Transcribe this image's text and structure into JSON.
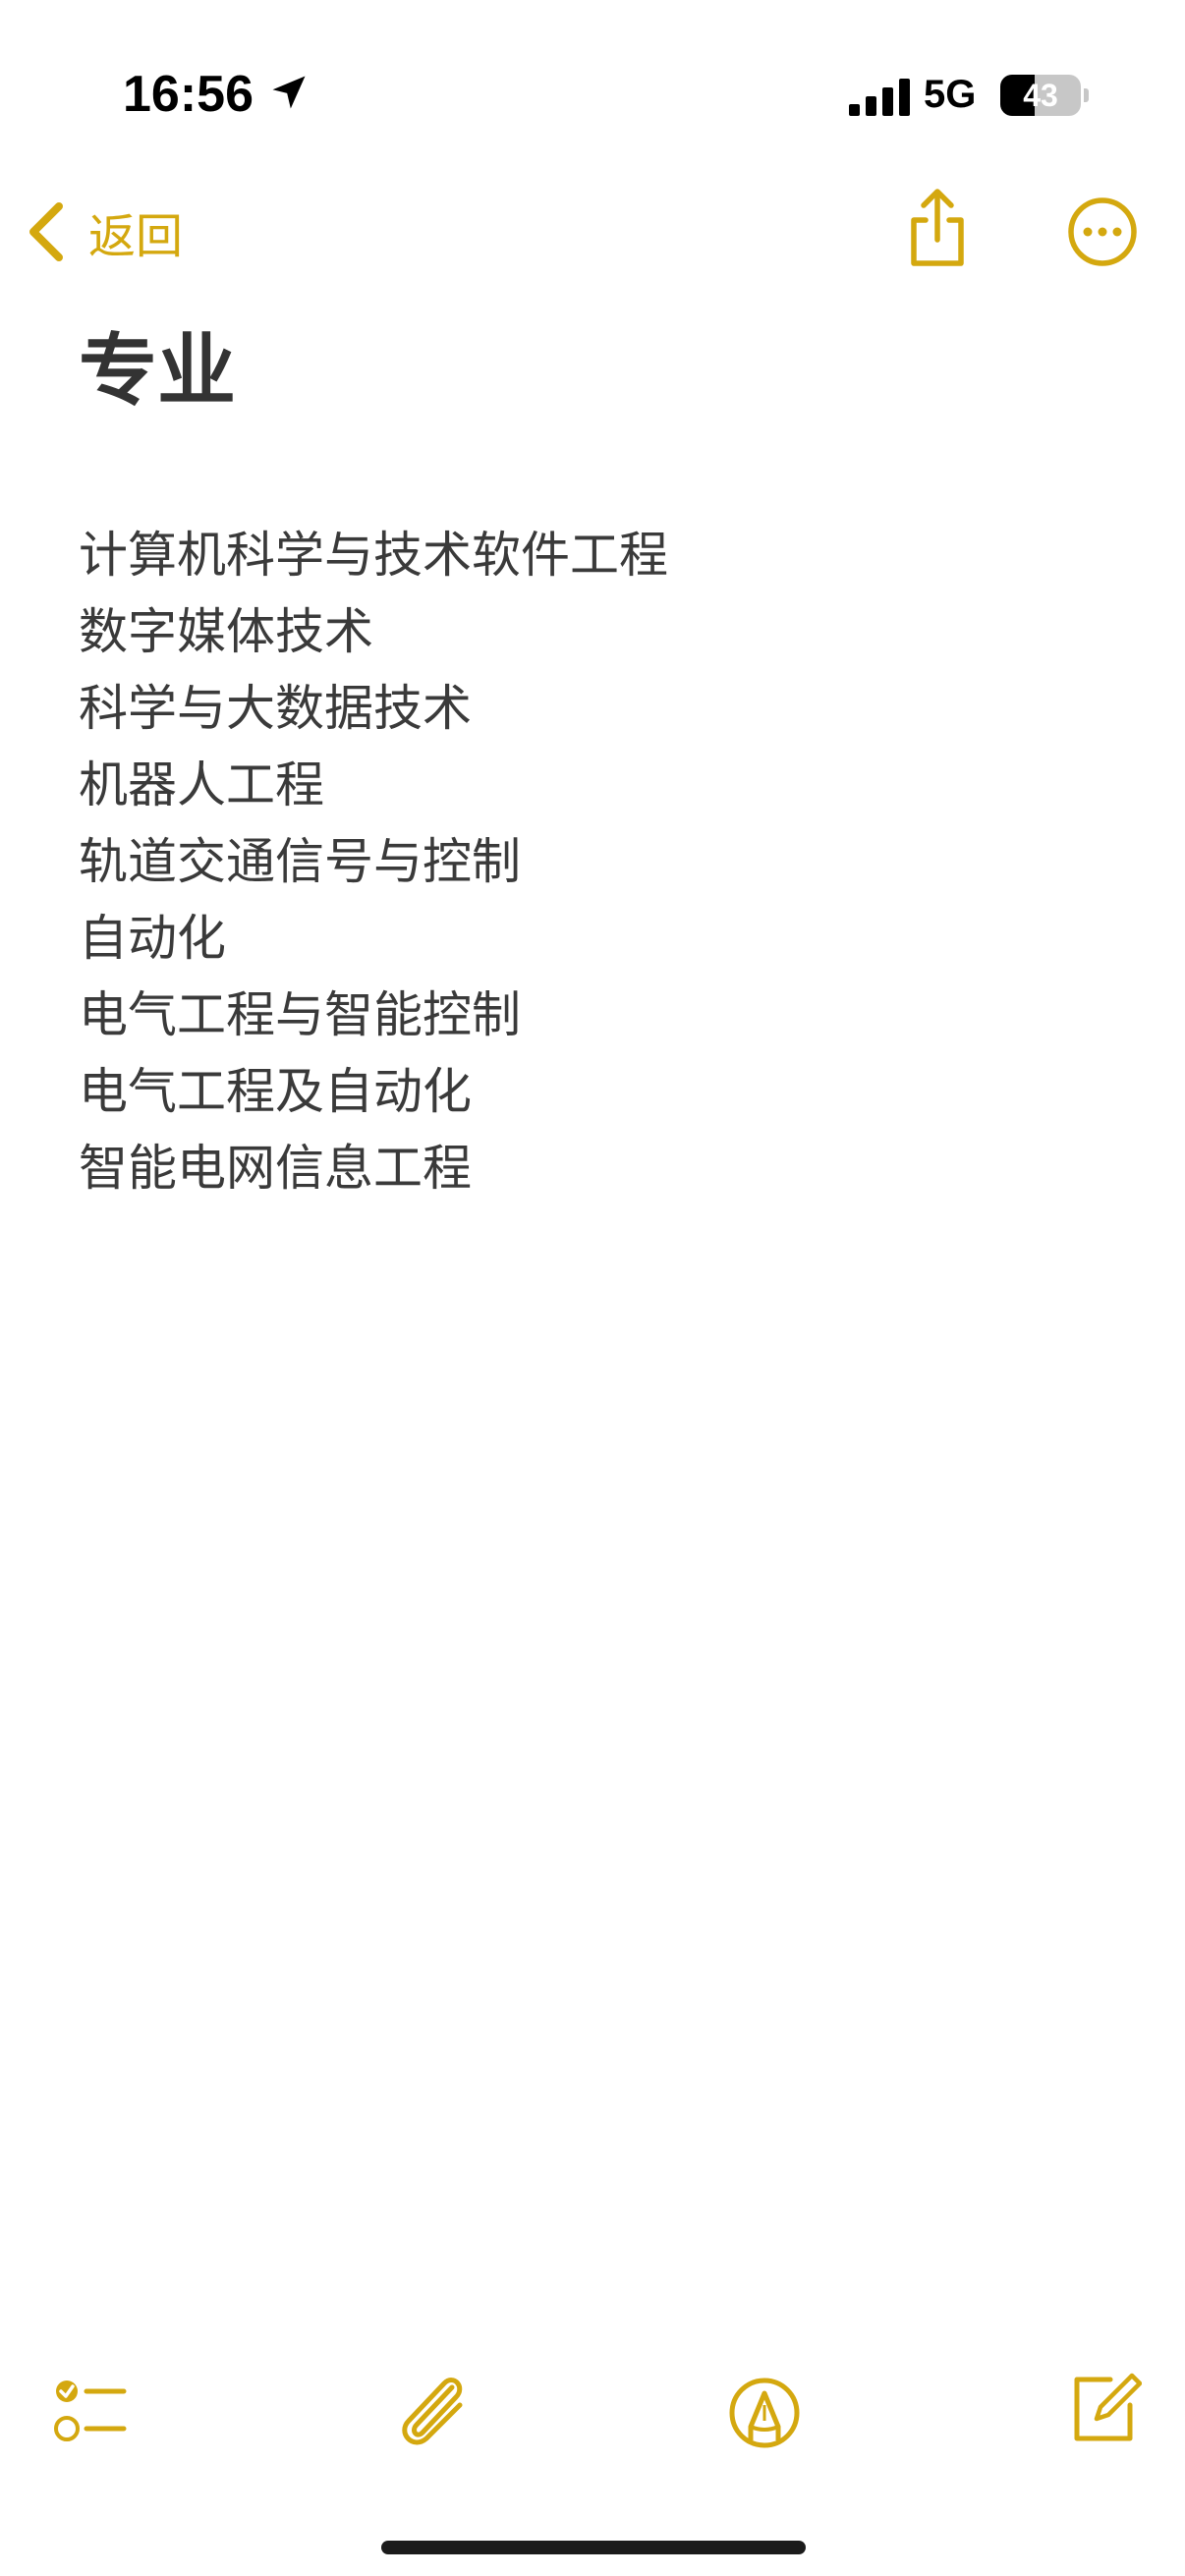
{
  "status_bar": {
    "time": "16:56",
    "network": "5G",
    "battery_level": "43",
    "battery_percent": 43
  },
  "nav": {
    "back_label": "返回"
  },
  "note": {
    "title": "专业",
    "lines": [
      "计算机科学与技术软件工程",
      "数字媒体技术",
      "科学与大数据技术",
      "机器人工程",
      "轨道交通信号与控制",
      "自动化",
      "电气工程与智能控制",
      "电气工程及自动化",
      "智能电网信息工程"
    ]
  },
  "icons": {
    "location": "location-arrow-icon",
    "signal": "cellular-signal-icon",
    "back": "chevron-left-icon",
    "share": "share-icon",
    "more": "ellipsis-circle-icon",
    "checklist": "checklist-icon",
    "attach": "paperclip-icon",
    "markup": "pen-tip-circle-icon",
    "compose": "compose-icon"
  },
  "colors": {
    "accent": "#D4A80F",
    "text": "#333333",
    "background": "#FFFFFF"
  }
}
